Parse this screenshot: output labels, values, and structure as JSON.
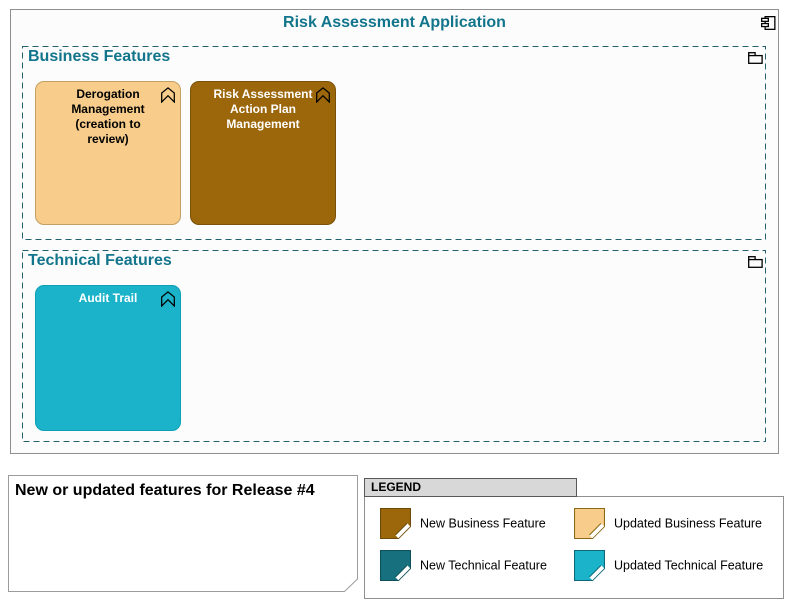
{
  "app": {
    "title": "Risk Assessment Application",
    "title_color": "#12758C",
    "container_fill": "#FCFCFC",
    "container_border": "#8F8F8F"
  },
  "groups": [
    {
      "title": "Business Features",
      "title_color": "#12758C",
      "border_color": "#23616F"
    },
    {
      "title": "Technical Features",
      "title_color": "#12758C",
      "border_color": "#23616F"
    }
  ],
  "features": [
    {
      "label": "Derogation Management (creation to review)",
      "group": "Business Features",
      "fill": "#F8CC8A",
      "border": "#C2A264",
      "text_color": "#000000",
      "kind": "Updated Business Feature"
    },
    {
      "label": "Risk Assessment Action Plan Management",
      "group": "Business Features",
      "fill": "#9C660B",
      "border": "#7A5106",
      "text_color": "#FFFFFF",
      "kind": "New Business Feature"
    },
    {
      "label": "Audit Trail",
      "group": "Technical Features",
      "fill": "#1BB3C9",
      "border": "#0FA0B5",
      "text_color": "#FFFFFF",
      "kind": "Updated Technical Feature"
    }
  ],
  "note": {
    "text": "New or updated features for Release #4"
  },
  "legend": {
    "title": "LEGEND",
    "items": [
      {
        "label": "New Business Feature",
        "color": "#9C660B",
        "border": "#6B4A08"
      },
      {
        "label": "Updated Business Feature",
        "color": "#F8CC8A",
        "border": "#8A6914"
      },
      {
        "label": "New Technical Feature",
        "color": "#17707E",
        "border": "#0D4F5A"
      },
      {
        "label": "Updated Technical Feature",
        "color": "#1AB3C9",
        "border": "#0E6776"
      }
    ]
  }
}
